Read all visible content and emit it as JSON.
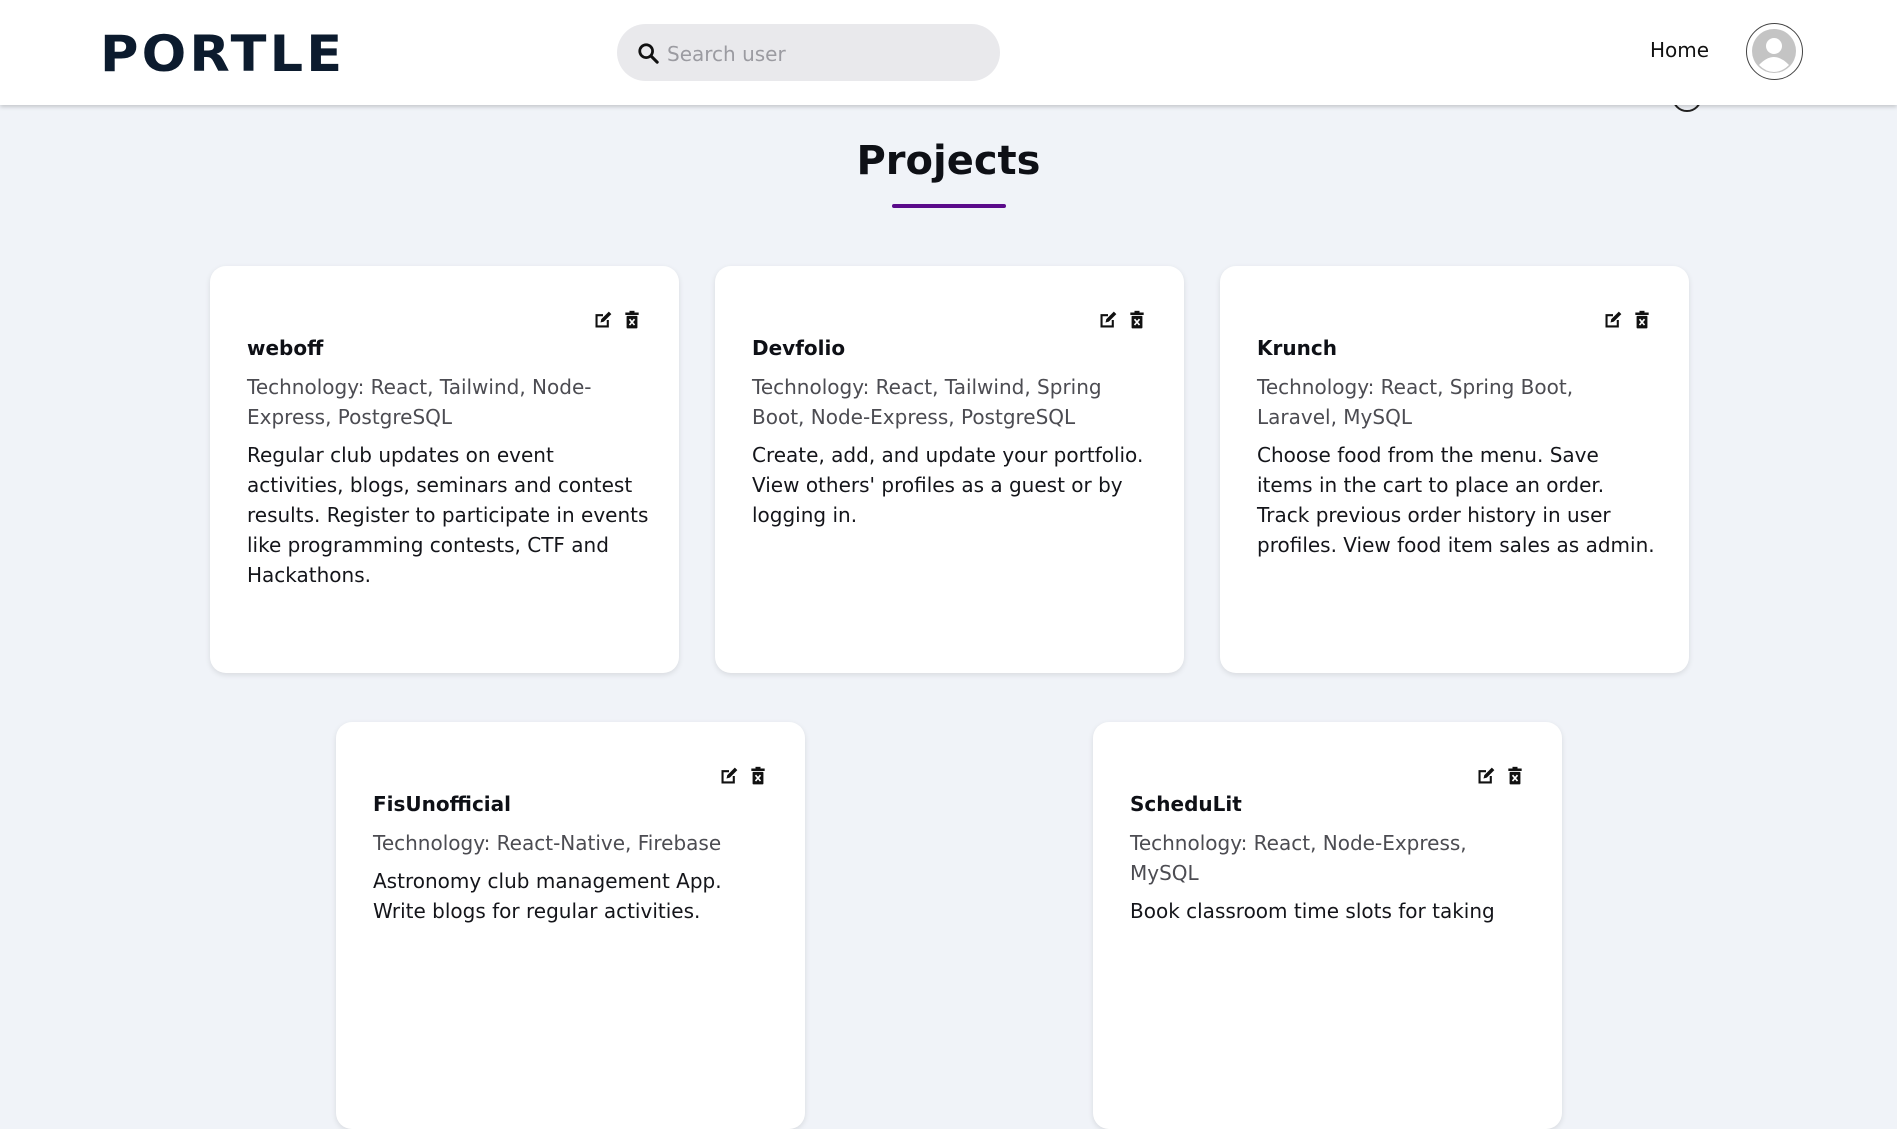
{
  "navbar": {
    "logo_text": "PORTLE",
    "search": {
      "placeholder": "Search user",
      "value": ""
    },
    "home_label": "Home"
  },
  "page": {
    "title": "Projects",
    "accent_color": "#5a0a8a"
  },
  "projects": [
    {
      "name": "weboff",
      "technology": "Technology: React, Tailwind, Node-Express, PostgreSQL",
      "description": "Regular club updates on event activities, blogs, seminars and contest results. Register to participate in events like programming contests, CTF and Hackathons."
    },
    {
      "name": "Devfolio",
      "technology": "Technology: React, Tailwind, Spring Boot, Node-Express, PostgreSQL",
      "description": "Create, add, and update your portfolio. View others' profiles as a guest or by logging in."
    },
    {
      "name": "Krunch",
      "technology": "Technology: React, Spring Boot, Laravel, MySQL",
      "description": "Choose food from the menu. Save items in the cart to place an order. Track previous order history in user profiles. View food item sales as admin."
    },
    {
      "name": "FisUnofficial",
      "technology": "Technology: React-Native, Firebase",
      "description": "Astronomy club management App. Write blogs for regular activities."
    },
    {
      "name": "ScheduLit",
      "technology": "Technology: React, Node-Express, MySQL",
      "description": "Book classroom time slots for taking"
    }
  ],
  "icons": {
    "search": "search-icon",
    "avatar": "user-avatar-icon",
    "edit": "edit-icon",
    "delete": "delete-icon"
  }
}
